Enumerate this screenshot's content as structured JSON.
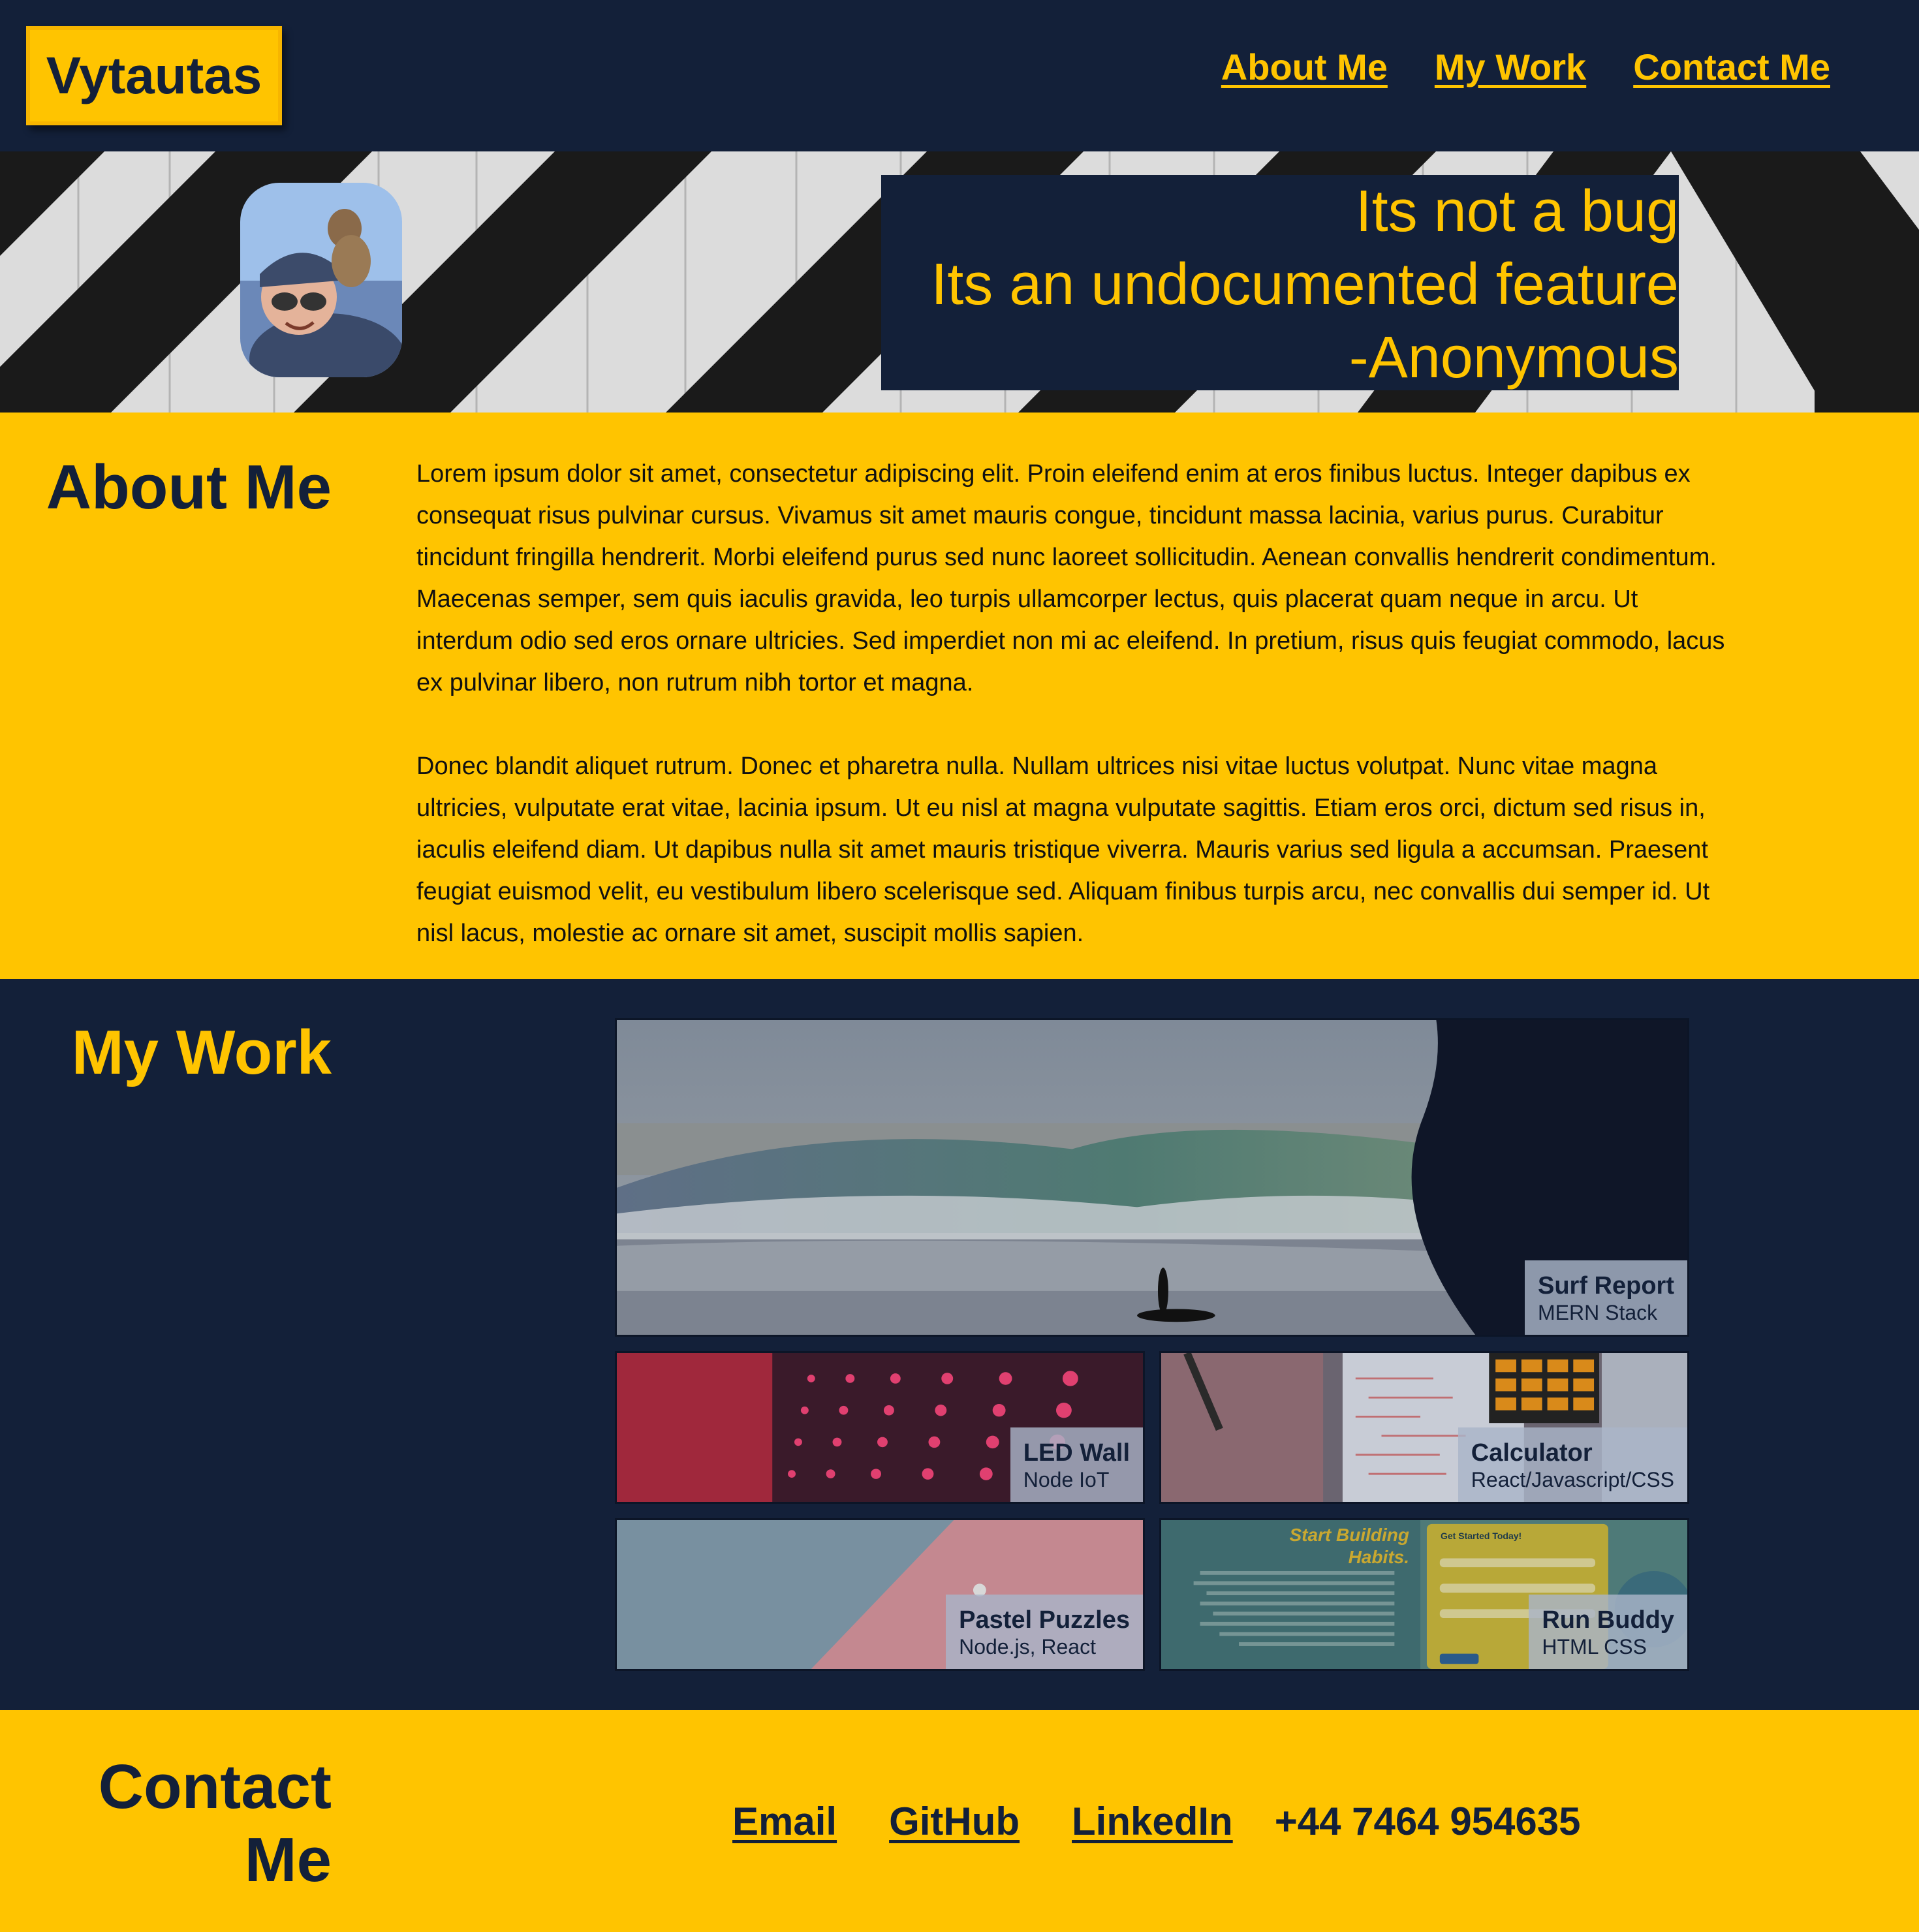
{
  "header": {
    "logo": "Vytautas",
    "nav": [
      "About Me",
      "My Work",
      "Contact Me"
    ]
  },
  "hero": {
    "quote_lines": [
      "Its not a bug",
      "Its an undocumented feature",
      "-Anonymous"
    ]
  },
  "about": {
    "title": "About Me",
    "paragraphs": [
      "Lorem ipsum dolor sit amet, consectetur adipiscing elit. Proin eleifend enim at eros finibus luctus. Integer dapibus ex consequat risus pulvinar cursus. Vivamus sit amet mauris congue, tincidunt massa lacinia, varius purus. Curabitur tincidunt fringilla hendrerit. Morbi eleifend purus sed nunc laoreet sollicitudin. Aenean convallis hendrerit condimentum. Maecenas semper, sem quis iaculis gravida, leo turpis ullamcorper lectus, quis placerat quam neque in arcu. Ut interdum odio sed eros ornare ultricies. Sed imperdiet non mi ac eleifend. In pretium, risus quis feugiat commodo, lacus ex pulvinar libero, non rutrum nibh tortor et magna.",
      "Donec blandit aliquet rutrum. Donec et pharetra nulla. Nullam ultrices nisi vitae luctus volutpat. Nunc vitae magna ultricies, vulputate erat vitae, lacinia ipsum. Ut eu nisl at magna vulputate sagittis. Etiam eros orci, dictum sed risus in, iaculis eleifend diam. Ut dapibus nulla sit amet mauris tristique viverra. Mauris varius sed ligula a accumsan. Praesent feugiat euismod velit, eu vestibulum libero scelerisque sed. Aliquam finibus turpis arcu, nec convallis dui semper id. Ut nisl lacus, molestie ac ornare sit amet, suscipit mollis sapien."
    ]
  },
  "work": {
    "title": "My Work",
    "projects": [
      {
        "title": "Surf Report",
        "stack": "MERN Stack"
      },
      {
        "title": "LED Wall",
        "stack": "Node IoT"
      },
      {
        "title": "Calculator",
        "stack": "React/Javascript/CSS"
      },
      {
        "title": "Pastel Puzzles",
        "stack": "Node.js, React"
      },
      {
        "title": "Run Buddy",
        "stack": "HTML CSS"
      }
    ],
    "run_buddy_thumb": {
      "heading": "Start Building Habits.",
      "form_title": "Get Started Today!"
    }
  },
  "contact": {
    "title_line1": "Contact",
    "title_line2": "Me",
    "links": [
      "Email",
      "GitHub",
      "LinkedIn"
    ],
    "phone": "+44 7464 954635"
  },
  "colors": {
    "navy": "#132039",
    "yellow": "#ffc400"
  }
}
